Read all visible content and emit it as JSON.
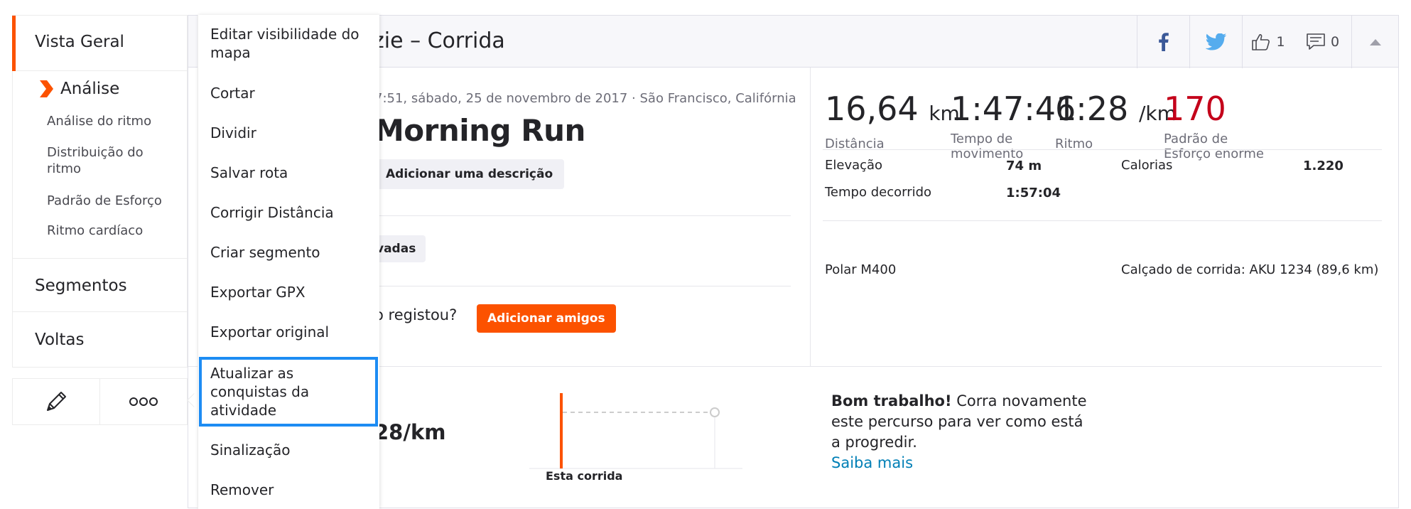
{
  "sidebar": {
    "overview": "Vista Geral",
    "analysis": "Análise",
    "sub_items": [
      "Análise do ritmo",
      "Distribuição do ritmo",
      "Padrão de Esforço",
      "Ritmo cardíaco"
    ],
    "segments": "Segmentos",
    "laps": "Voltas",
    "accent_color": "#fc5200"
  },
  "header": {
    "title": "zie – Corrida",
    "likes_count": "1",
    "comments_count": "0"
  },
  "activity": {
    "meta": "7:51, sábado, 25 de novembro de 2017 · São Francisco, Califórnia",
    "name": "Morning Run",
    "add_description": "Adicionar uma descrição",
    "kudos_label": "vadas",
    "who_recorded": "o registou?",
    "add_friends": "Adicionar amigos"
  },
  "stats": {
    "distance": {
      "value": "16,64",
      "unit": "km",
      "label": "Distância"
    },
    "moving_time": {
      "value": "1:47:41",
      "label": "Tempo de movimento"
    },
    "pace": {
      "value": "6:28",
      "unit": "/km",
      "label": "Ritmo"
    },
    "effort": {
      "value": "170",
      "label": "Padrão de Esforço enorme"
    },
    "elevation_label": "Elevação",
    "elevation_value": "74 m",
    "calories_label": "Calorias",
    "calories_value": "1.220",
    "elapsed_label": "Tempo decorrido",
    "elapsed_value": "1:57:04",
    "device": "Polar M400",
    "shoes": "Calçado de corrida: AKU 1234 (89,6 km)"
  },
  "comparison": {
    "pace_big": "28/km",
    "chart_label": "Esta corrida",
    "good_job": "Bom trabalho!",
    "message": " Corra novamente este percurso para ver como está a progredir.",
    "learn_more": "Saiba mais"
  },
  "menu": {
    "items": [
      "Editar visibilidade do mapa",
      "Cortar",
      "Dividir",
      "Salvar rota",
      "Corrigir Distância",
      "Criar segmento",
      "Exportar GPX",
      "Exportar original",
      "Atualizar as conquistas da atividade",
      "Sinalização",
      "Remover"
    ],
    "highlight_color": "#1d8cf3"
  },
  "icons": {
    "edit": "pencil-icon",
    "more": "ellipsis-icon",
    "facebook": "facebook-icon",
    "twitter": "twitter-icon",
    "like": "thumbs-up-icon",
    "comment": "comment-icon",
    "collapse": "triangle-up-icon"
  }
}
